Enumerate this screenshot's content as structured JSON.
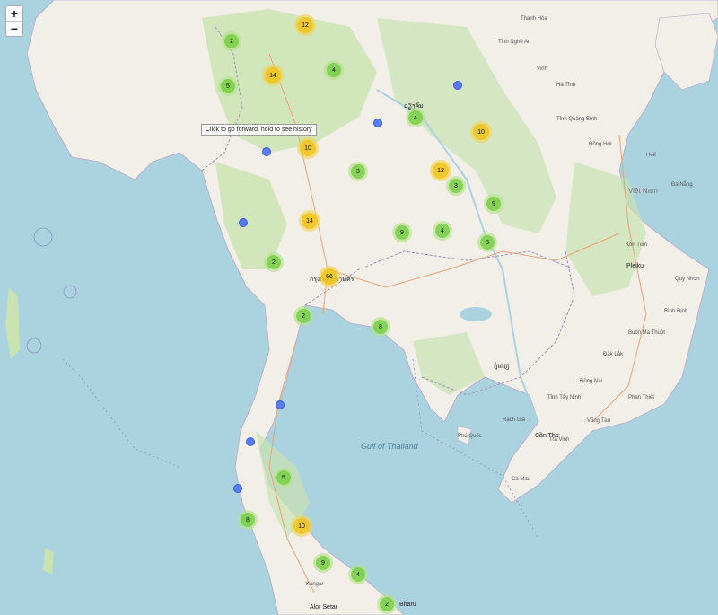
{
  "controls": {
    "zoom_in": "+",
    "zoom_out": "−"
  },
  "tooltip": "Click to go forward, hold to see history",
  "labels": {
    "gulf": "Gulf of Thailand",
    "phnom_penh": "ភ្នំពេញ",
    "bangkok": "กรุงเทพมหานคร",
    "vientiane": "ວຽງຈັນ",
    "pleiku": "Pleiku",
    "viet_nam": "Việt Nam",
    "can_tho": "Cần Thơ",
    "phu_quoc": "Phú Quốc",
    "kon_tum": "Kon Tum",
    "quy_nhon": "Quy Nhơn",
    "hue": "Huế",
    "da_nang": "Đà Nẵng",
    "buon_ma_thuot": "Buôn Ma Thuột",
    "dong_hoi": "Đồng Hới",
    "phan_thiet": "Phan Thiết",
    "alor_setar": "Alor Setar",
    "thanh_hoa": "Thanh Hóa",
    "vinh": "Vinh",
    "nghe_an": "Tỉnh Nghệ An",
    "ha_tinh": "Hà Tĩnh",
    "kangar": "Kangar",
    "bharu": "Bharu",
    "tay": "Tỉnh Tây Ninh",
    "dong_nai": "Đồng Nai",
    "ca_mau": "Cà Mau",
    "rach_gia": "Rạch Giá",
    "tra_vinh": "Trà Vinh",
    "vung_tau": "Vũng Tàu",
    "dak_lak": "Đắk Lắk",
    "binh_dinh": "Bình Định",
    "quang_binh": "Tỉnh Quảng Bình"
  },
  "clusters": [
    {
      "count": "12",
      "color": "y"
    },
    {
      "count": "2",
      "color": "g"
    },
    {
      "count": "14",
      "color": "y"
    },
    {
      "count": "4",
      "color": "g"
    },
    {
      "count": "5",
      "color": "g"
    },
    {
      "count": "4",
      "color": "g"
    },
    {
      "count": "10",
      "color": "y"
    },
    {
      "count": "10",
      "color": "y"
    },
    {
      "count": "3",
      "color": "g"
    },
    {
      "count": "12",
      "color": "y"
    },
    {
      "count": "3",
      "color": "g"
    },
    {
      "count": "9",
      "color": "g"
    },
    {
      "count": "14",
      "color": "y"
    },
    {
      "count": "9",
      "color": "g"
    },
    {
      "count": "4",
      "color": "g"
    },
    {
      "count": "3",
      "color": "g"
    },
    {
      "count": "2",
      "color": "g"
    },
    {
      "count": "66",
      "color": "y"
    },
    {
      "count": "2",
      "color": "g"
    },
    {
      "count": "8",
      "color": "g"
    },
    {
      "count": "5",
      "color": "g"
    },
    {
      "count": "8",
      "color": "g"
    },
    {
      "count": "10",
      "color": "y"
    },
    {
      "count": "9",
      "color": "g"
    },
    {
      "count": "4",
      "color": "g"
    },
    {
      "count": "2",
      "color": "g"
    }
  ],
  "colors": {
    "water": "#aad3df",
    "land": "#f2efe9",
    "forest": "#c9e3b0",
    "cluster_small": "#6ecc39",
    "cluster_medium": "#f0c20c",
    "pin": "#5a7cf0"
  }
}
